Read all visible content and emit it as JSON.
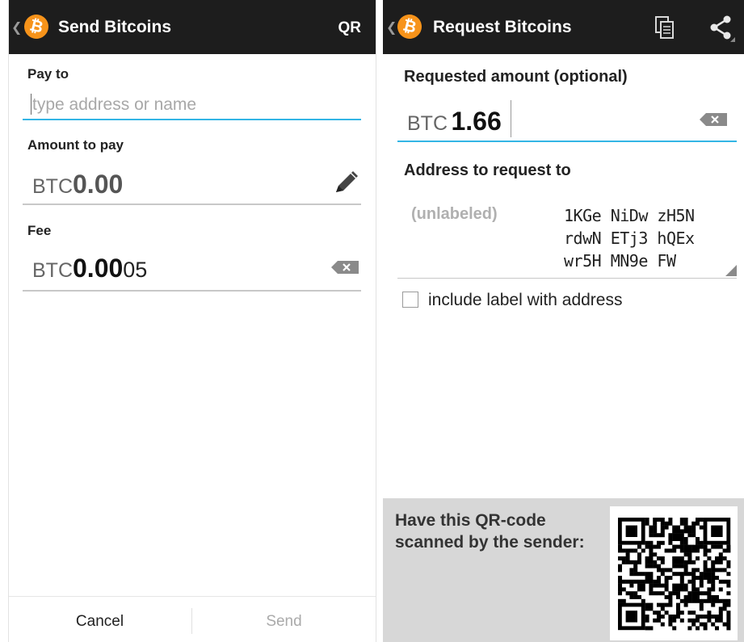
{
  "send": {
    "title": "Send Bitcoins",
    "qr_action": "QR",
    "pay_to_label": "Pay to",
    "pay_to_placeholder": "type address or name",
    "amount_label": "Amount to pay",
    "amount_currency": "BTC",
    "amount_value": "0.00",
    "fee_label": "Fee",
    "fee_currency": "BTC",
    "fee_value_bold": "0.00",
    "fee_value_rest": "05",
    "cancel_label": "Cancel",
    "send_label": "Send"
  },
  "request": {
    "title": "Request Bitcoins",
    "amount_label": "Requested amount (optional)",
    "amount_currency": "BTC",
    "amount_value": "1.66",
    "address_label": "Address to request to",
    "address_tag": "(unlabeled)",
    "address_lines": [
      "1KGe NiDw zH5N",
      "rdwN ETj3 hQEx",
      "wr5H MN9e FW"
    ],
    "include_label_text": "include label with address",
    "include_label_checked": false,
    "qr_caption_line1": "Have this QR-code",
    "qr_caption_line2": "scanned by the sender:"
  },
  "colors": {
    "action_bar": "#1d1d1d",
    "accent": "#33b5e5",
    "bitcoin_orange": "#f7931a",
    "qr_panel": "#d7d7d7"
  }
}
